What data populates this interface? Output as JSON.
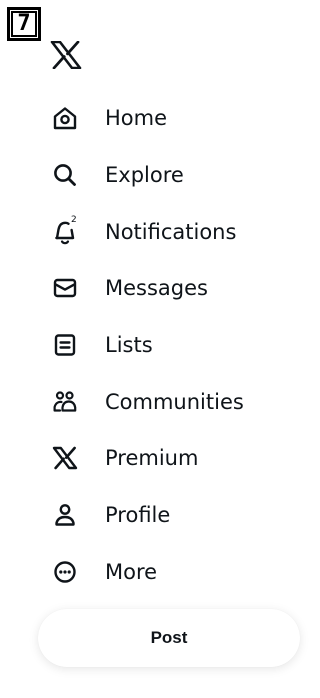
{
  "marker": {
    "number": "7"
  },
  "app": {
    "logo": "x-logo-icon"
  },
  "nav": {
    "items": [
      {
        "label": "Home",
        "icon": "home-icon"
      },
      {
        "label": "Explore",
        "icon": "search-icon"
      },
      {
        "label": "Notifications",
        "icon": "bell-icon",
        "badge": "2"
      },
      {
        "label": "Messages",
        "icon": "envelope-icon"
      },
      {
        "label": "Lists",
        "icon": "list-icon"
      },
      {
        "label": "Communities",
        "icon": "communities-icon"
      },
      {
        "label": "Premium",
        "icon": "x-premium-icon"
      },
      {
        "label": "Profile",
        "icon": "person-icon"
      },
      {
        "label": "More",
        "icon": "more-circle-icon"
      }
    ]
  },
  "post_button": {
    "label": "Post"
  },
  "colors": {
    "text": "#0f1419",
    "background": "#ffffff"
  }
}
